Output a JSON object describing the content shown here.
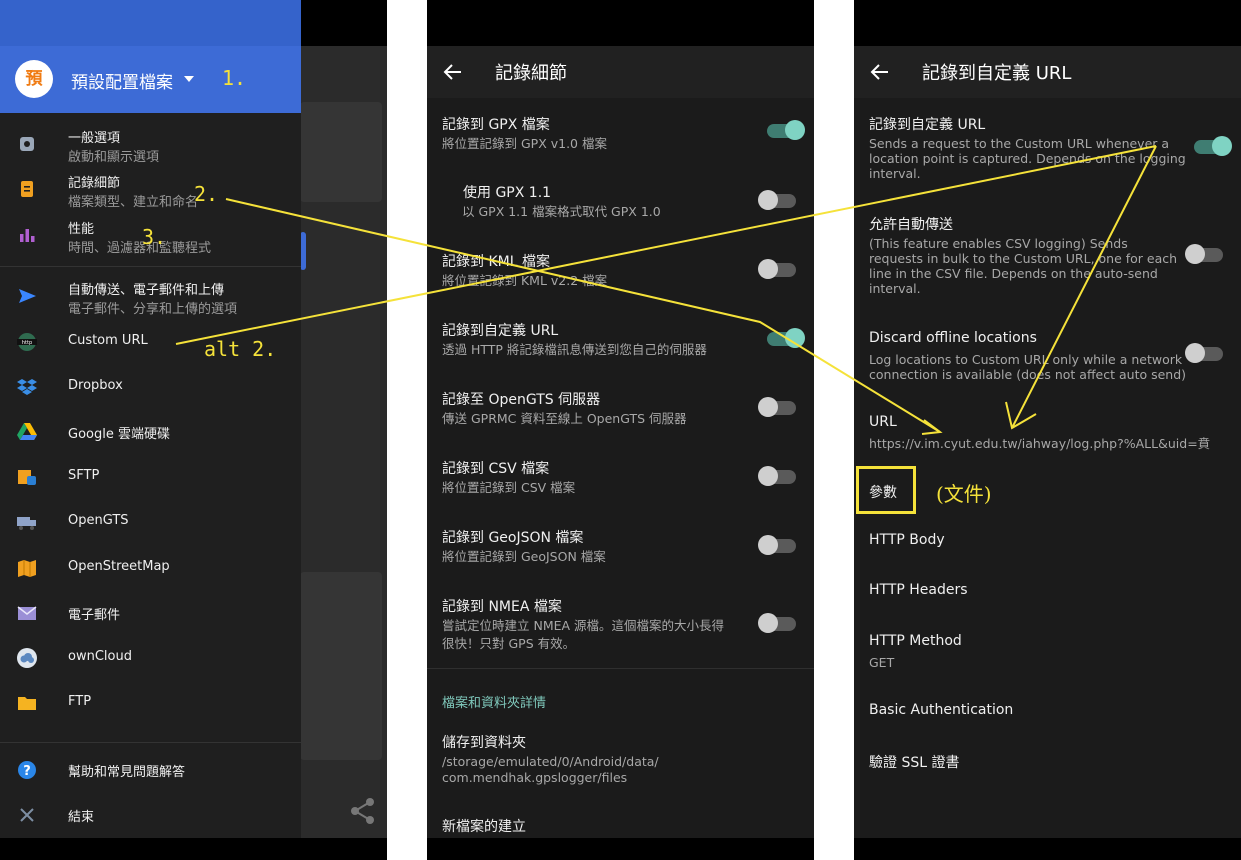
{
  "left_drawer": {
    "avatar_letter": "預",
    "profile_name": "預設配置檔案",
    "items": [
      {
        "icon": "gear-icon",
        "title": "一般選項",
        "subtitle": "啟動和顯示選項"
      },
      {
        "icon": "clipboard-icon",
        "title": "記錄細節",
        "subtitle": "檔案類型、建立和命名"
      },
      {
        "icon": "bar-chart-icon",
        "title": "性能",
        "subtitle": "時間、過濾器和監聽程式"
      },
      {
        "icon": "send-icon",
        "title": "自動傳送、電子郵件和上傳",
        "subtitle": "電子郵件、分享和上傳的選項"
      },
      {
        "icon": "http-icon",
        "title": "Custom URL"
      },
      {
        "icon": "dropbox-icon",
        "title": "Dropbox"
      },
      {
        "icon": "google-drive-icon",
        "title": "Google 雲端硬碟"
      },
      {
        "icon": "sftp-icon",
        "title": "SFTP"
      },
      {
        "icon": "truck-icon",
        "title": "OpenGTS"
      },
      {
        "icon": "map-icon",
        "title": "OpenStreetMap"
      },
      {
        "icon": "mail-icon",
        "title": "電子郵件"
      },
      {
        "icon": "cloud-icon",
        "title": "ownCloud"
      },
      {
        "icon": "folder-icon",
        "title": "FTP"
      },
      {
        "icon": "help-icon",
        "title": "幫助和常見問題解答"
      },
      {
        "icon": "close-icon",
        "title": "結束"
      }
    ]
  },
  "annotations": {
    "a1": "1.",
    "a2": "2.",
    "a3": "3.",
    "alt2": "alt 2.",
    "doc": "(文件)"
  },
  "middle": {
    "title": "記錄細節",
    "rows": [
      {
        "title": "記錄到 GPX 檔案",
        "subtitle": "將位置記錄到 GPX v1.0 檔案",
        "on": true
      },
      {
        "title": "使用 GPX 1.1",
        "subtitle": "以 GPX 1.1 檔案格式取代 GPX 1.0",
        "on": false
      },
      {
        "title": "記錄到 KML 檔案",
        "subtitle": "將位置記錄到 KML v2.2 檔案",
        "on": false
      },
      {
        "title": "記錄到自定義 URL",
        "subtitle": "透過 HTTP 將記錄檔訊息傳送到您自己的伺服器",
        "on": true
      },
      {
        "title": "記錄至 OpenGTS 伺服器",
        "subtitle": "傳送 GPRMC 資料至線上 OpenGTS 伺服器",
        "on": false
      },
      {
        "title": "記錄到 CSV 檔案",
        "subtitle": "將位置記錄到 CSV 檔案",
        "on": false
      },
      {
        "title": "記錄到 GeoJSON 檔案",
        "subtitle": "將位置記錄到 GeoJSON 檔案",
        "on": false
      },
      {
        "title": "記錄到 NMEA 檔案",
        "subtitle1": "嘗試定位時建立 NMEA 源檔。這個檔案的大小長得",
        "subtitle2": "很快！只對 GPS 有效。",
        "on": false
      }
    ],
    "category": "檔案和資料夾詳情",
    "folder_title": "儲存到資料夾",
    "folder_path1": "/storage/emulated/0/Android/data/",
    "folder_path2": "com.mendhak.gpslogger/files",
    "new_file": "新檔案的建立"
  },
  "right": {
    "title": "記錄到自定義 URL",
    "log_title": "記錄到自定義 URL",
    "log_desc": [
      "Sends a request to the Custom URL whenever a",
      "location point is captured. Depends on the logging",
      "interval."
    ],
    "auto_title": "允許自動傳送",
    "auto_desc": [
      "(This feature enables CSV logging) Sends",
      "requests in bulk to the Custom URL, one for each",
      "line in the CSV file. Depends on the auto-send",
      "interval."
    ],
    "discard_title": "Discard offline locations",
    "discard_desc": [
      "Log locations to Custom URL only while a network",
      "connection is available (does not affect auto send)"
    ],
    "url_label": "URL",
    "url_value": "https://v.im.cyut.edu.tw/iahway/log.php?%ALL&uid=賁",
    "params": "參數",
    "http_body": "HTTP Body",
    "http_headers": "HTTP Headers",
    "http_method": "HTTP Method",
    "http_method_value": "GET",
    "basic_auth": "Basic Authentication",
    "ssl": "驗證 SSL 證書"
  },
  "colors": {
    "accent": "#7fd3c3",
    "annotation": "#f5e23a",
    "drawer_header": "#3d6bd6"
  }
}
